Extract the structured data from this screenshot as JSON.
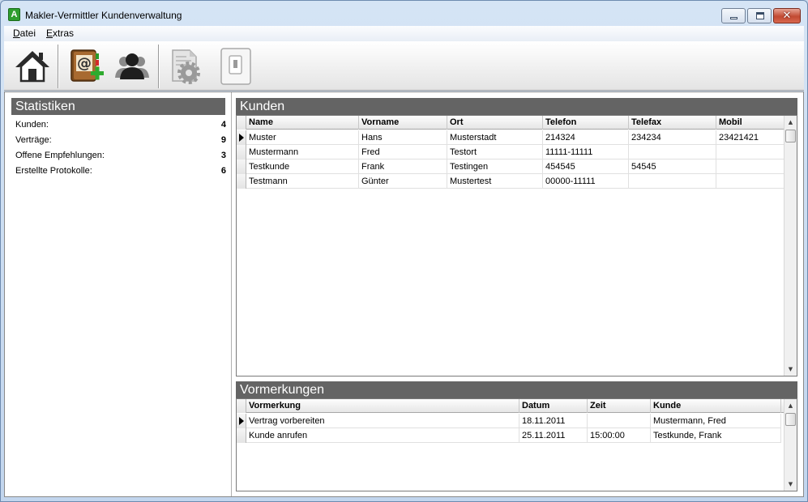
{
  "window": {
    "title": "Makler-Vermittler Kundenverwaltung",
    "app_icon_letter": "A"
  },
  "menu": {
    "items": [
      "Datei",
      "Extras"
    ]
  },
  "toolbar": {
    "buttons": [
      "home-icon",
      "address-book-add-icon",
      "users-icon",
      "settings-document-icon",
      "switch-icon"
    ]
  },
  "stats": {
    "title": "Statistiken",
    "rows": [
      {
        "label": "Kunden:",
        "value": "4"
      },
      {
        "label": "Verträge:",
        "value": "9"
      },
      {
        "label": "Offene Empfehlungen:",
        "value": "3"
      },
      {
        "label": "Erstellte Protokolle:",
        "value": "6"
      }
    ]
  },
  "customers": {
    "title": "Kunden",
    "columns": [
      "Name",
      "Vorname",
      "Ort",
      "Telefon",
      "Telefax",
      "Mobil"
    ],
    "rows": [
      [
        "Muster",
        "Hans",
        "Musterstadt",
        "214324",
        "234234",
        "23421421"
      ],
      [
        "Mustermann",
        "Fred",
        "Testort",
        "11111-11111",
        "",
        ""
      ],
      [
        "Testkunde",
        "Frank",
        "Testingen",
        "454545",
        "54545",
        ""
      ],
      [
        "Testmann",
        "Günter",
        "Mustertest",
        "00000-11111",
        "",
        ""
      ]
    ]
  },
  "reminders": {
    "title": "Vormerkungen",
    "columns": [
      "Vormerkung",
      "Datum",
      "Zeit",
      "Kunde"
    ],
    "rows": [
      [
        "Vertrag vorbereiten",
        "18.11.2011",
        "",
        "Mustermann, Fred"
      ],
      [
        "Kunde anrufen",
        "25.11.2011",
        "15:00:00",
        "Testkunde, Frank"
      ]
    ]
  }
}
